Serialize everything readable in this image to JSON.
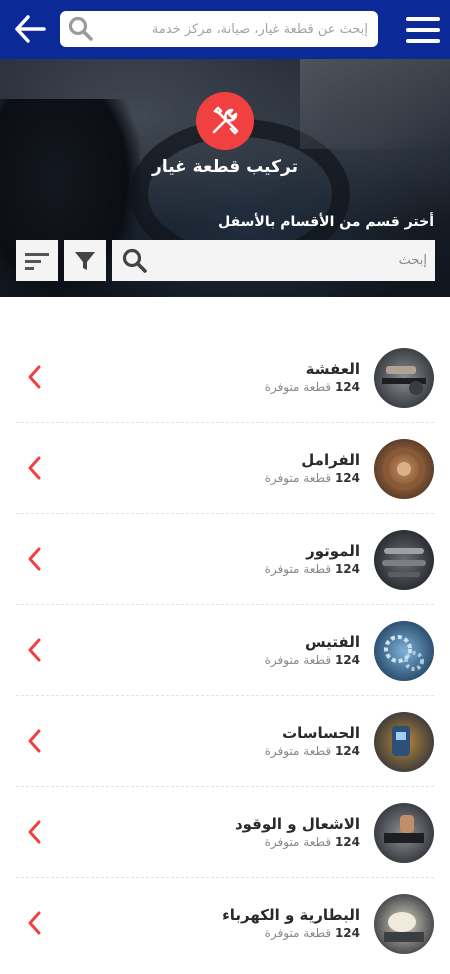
{
  "header": {
    "search_placeholder": "إبحث عن قطعة غيار، صيانة، مركز خدمة",
    "back_icon": "arrow-left-icon",
    "menu_icon": "hamburger-menu-icon",
    "search_icon": "search-icon"
  },
  "hero": {
    "icon": "wrench-screwdriver-icon",
    "title": "تركيب قطعة غيار",
    "subtitle": "أختر قسم من الأقسام بالأسفل",
    "search_placeholder": "إبحث",
    "accent_color": "#f0403f"
  },
  "colors": {
    "brand": "#0b2a97",
    "accent": "#f0403f"
  },
  "categories": [
    {
      "title": "العفشة",
      "count": "124",
      "count_label": "قطعة متوفرة"
    },
    {
      "title": "الفرامل",
      "count": "124",
      "count_label": "قطعة متوفرة"
    },
    {
      "title": "الموتور",
      "count": "124",
      "count_label": "قطعة متوفرة"
    },
    {
      "title": "الفتيس",
      "count": "124",
      "count_label": "قطعة متوفرة"
    },
    {
      "title": "الحساسات",
      "count": "124",
      "count_label": "قطعة متوفرة"
    },
    {
      "title": "الاشعال و الوقود",
      "count": "124",
      "count_label": "قطعة متوفرة"
    },
    {
      "title": "البطارية و الكهرباء",
      "count": "124",
      "count_label": "قطعة متوفرة"
    }
  ]
}
